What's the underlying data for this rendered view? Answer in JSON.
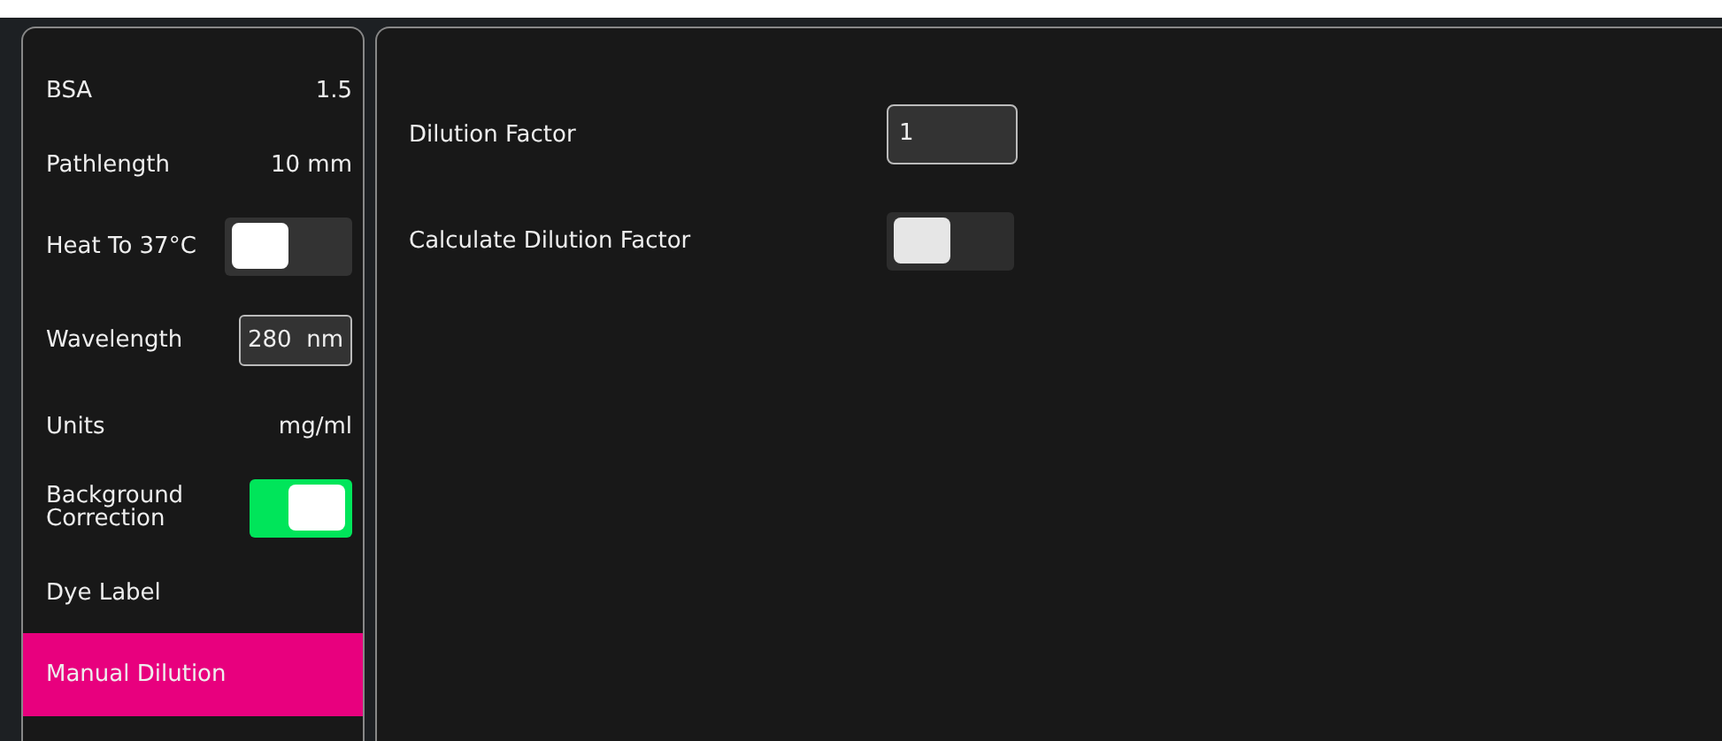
{
  "sidebar": {
    "items": [
      {
        "kind": "value",
        "label": "BSA",
        "value": "1.5",
        "selected": false
      },
      {
        "kind": "value",
        "label": "Pathlength",
        "value": "10 mm",
        "selected": false
      },
      {
        "kind": "toggle",
        "label": "Heat To 37°C",
        "on": false,
        "selected": false
      },
      {
        "kind": "field",
        "label": "Wavelength",
        "value": "280  nm",
        "selected": false
      },
      {
        "kind": "value",
        "label": "Units",
        "value": "mg/ml",
        "selected": false
      },
      {
        "kind": "toggle",
        "label": "Background Correction",
        "on": true,
        "selected": false
      },
      {
        "kind": "link",
        "label": "Dye Label",
        "selected": false
      },
      {
        "kind": "link",
        "label": "Manual Dilution",
        "selected": true
      }
    ]
  },
  "settings": [
    {
      "kind": "field",
      "label": "Dilution Factor",
      "value": "1"
    },
    {
      "kind": "toggle",
      "label": "Calculate Dilution Factor",
      "on": false
    }
  ]
}
